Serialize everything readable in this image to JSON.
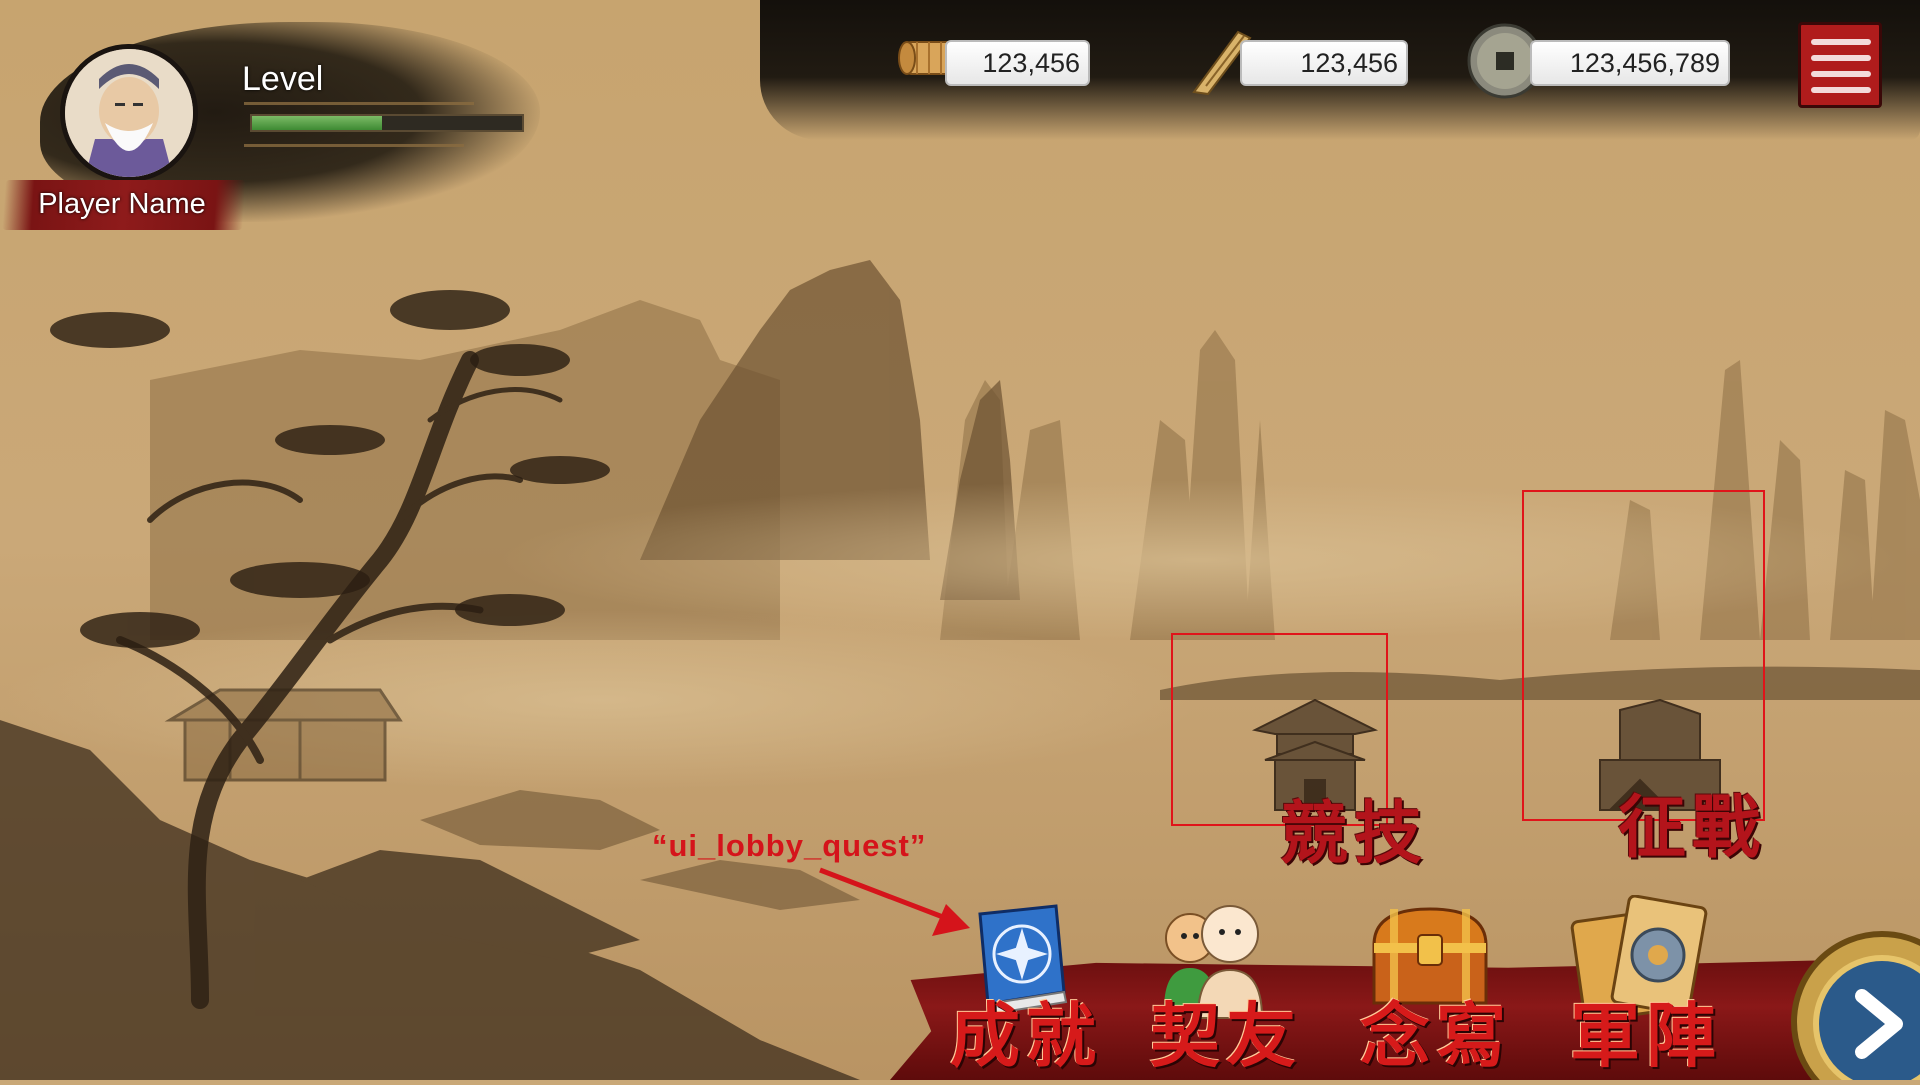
{
  "player": {
    "level_label": "Level",
    "name": "Player Name",
    "level_progress": 0.48
  },
  "resources": [
    {
      "icon": "scroll-icon",
      "value": "123,456"
    },
    {
      "icon": "bamboo-slip-icon",
      "value": "123,456"
    },
    {
      "icon": "coin-icon",
      "value": "123,456,789"
    }
  ],
  "locations": {
    "arena_label": "競技",
    "campaign_label": "征戰"
  },
  "annotation": {
    "label": "“ui_lobby_quest”"
  },
  "bottom_menu": [
    {
      "icon": "quest-book-icon",
      "label": "成就"
    },
    {
      "icon": "friends-icon",
      "label": "契友"
    },
    {
      "icon": "treasure-chest-icon",
      "label": "念寫"
    },
    {
      "icon": "cards-icon",
      "label": "軍陣"
    }
  ],
  "colors": {
    "accent_red": "#b3141b",
    "banner_red": "#8a1818",
    "parchment": "#c9a877",
    "level_bar": "#4f9a3f"
  }
}
